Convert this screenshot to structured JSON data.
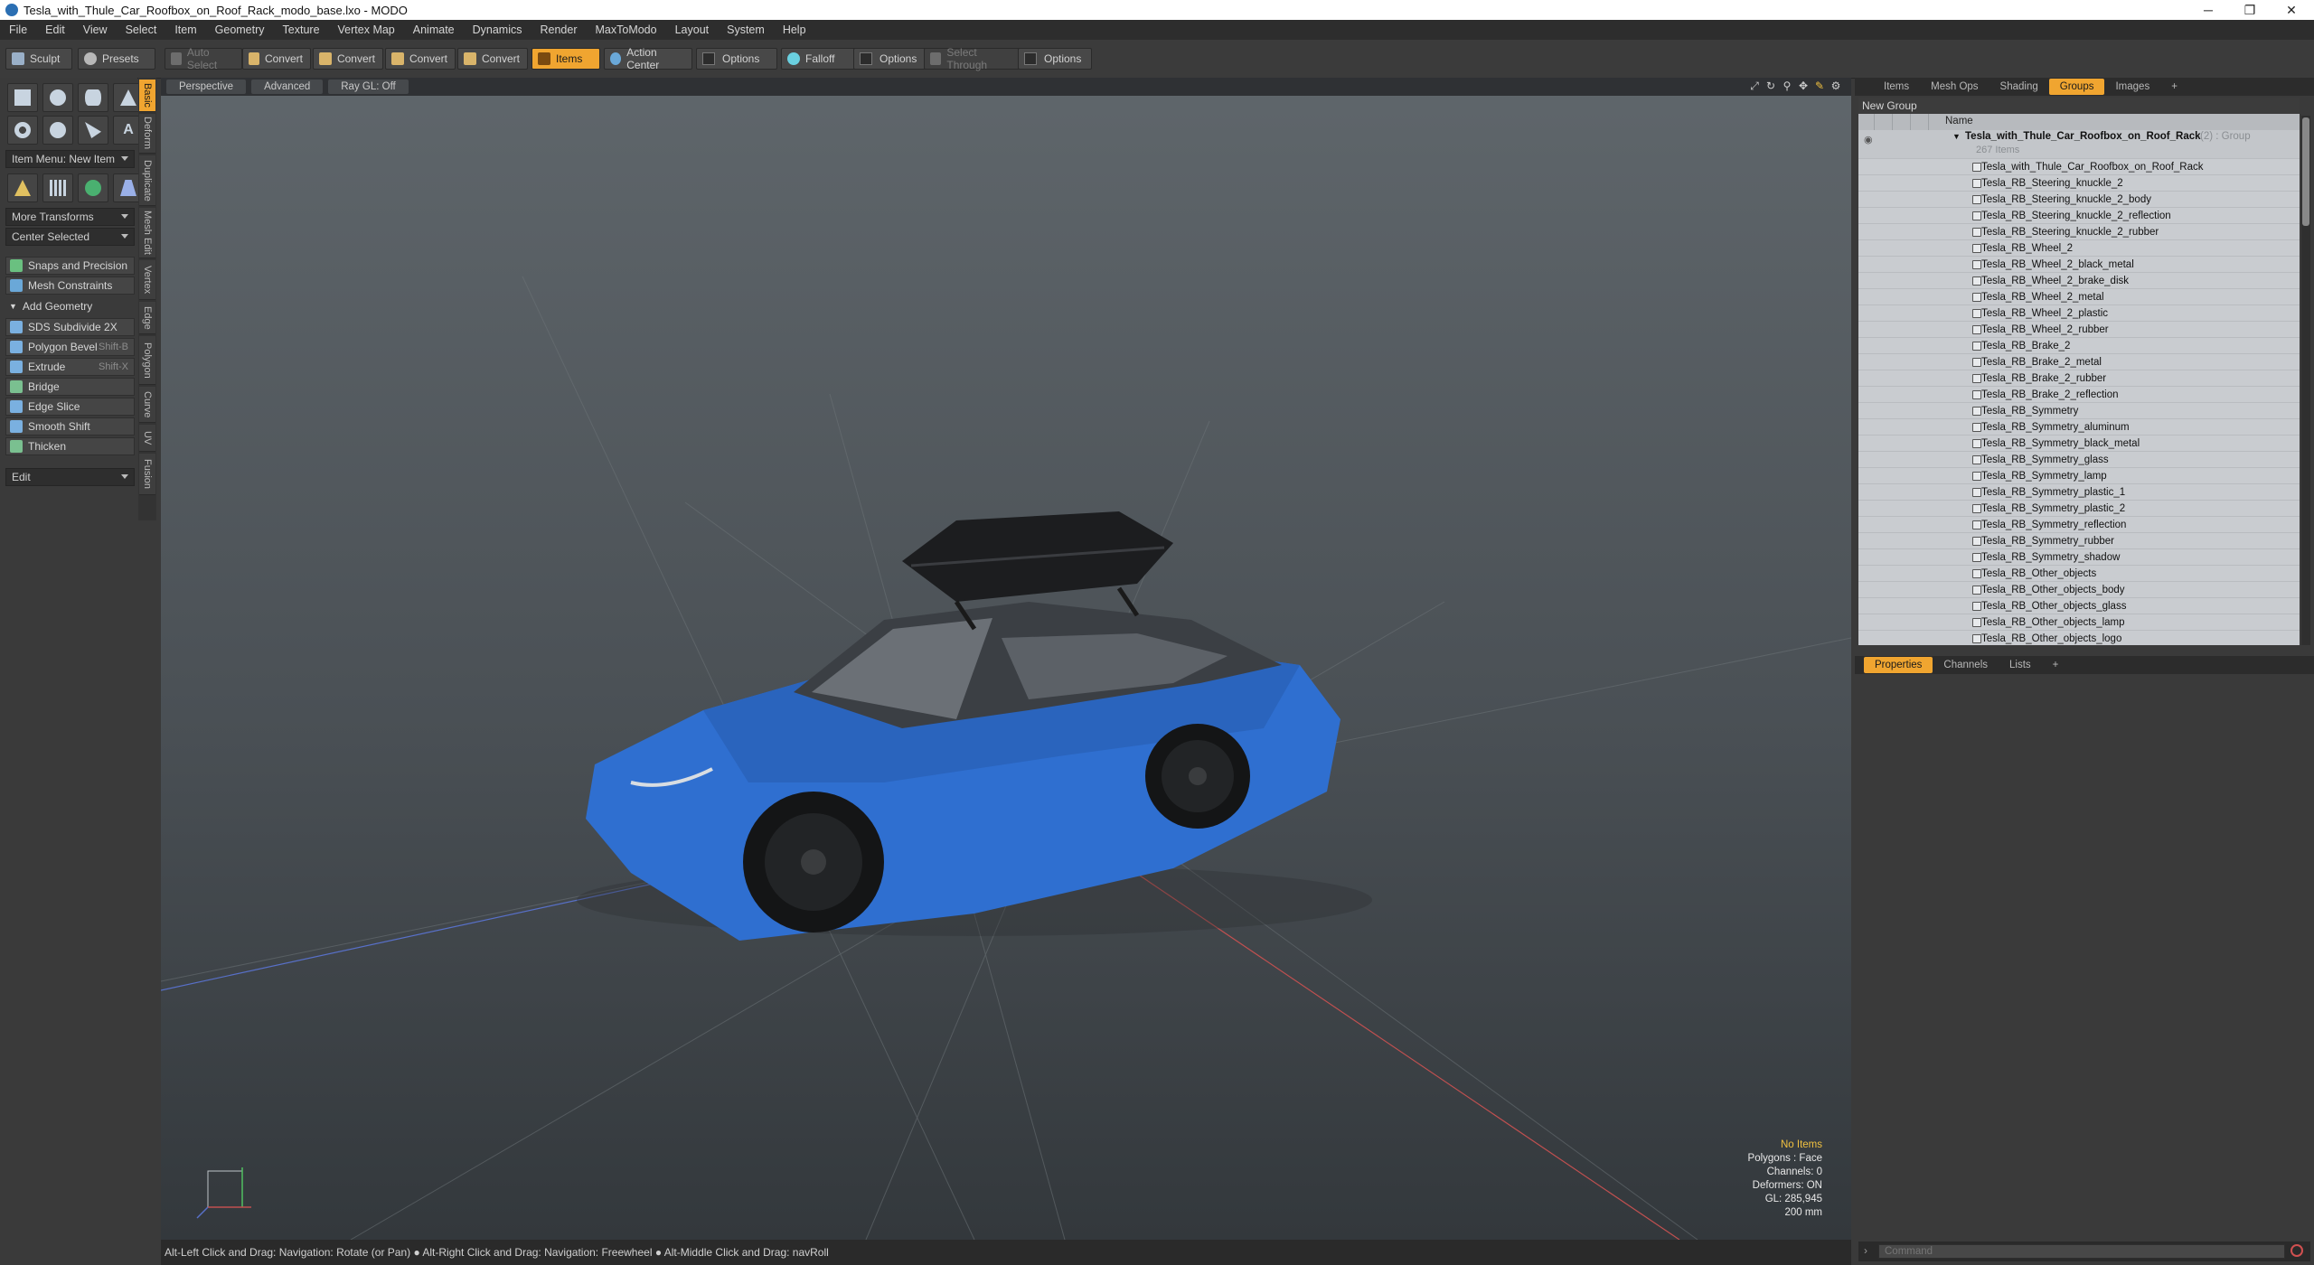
{
  "window": {
    "title": "Tesla_with_Thule_Car_Roofbox_on_Roof_Rack_modo_base.lxo - MODO",
    "minimize_glyph": "─",
    "maximize_glyph": "❐",
    "close_glyph": "✕"
  },
  "menu": [
    "File",
    "Edit",
    "View",
    "Select",
    "Item",
    "Geometry",
    "Texture",
    "Vertex Map",
    "Animate",
    "Dynamics",
    "Render",
    "MaxToModo",
    "Layout",
    "System",
    "Help"
  ],
  "toolbar": {
    "sculpt": "Sculpt",
    "presets": "Presets",
    "auto_select": "Auto Select",
    "convert1": "Convert",
    "convert2": "Convert",
    "convert3": "Convert",
    "convert4": "Convert",
    "items": "Items",
    "action_center": "Action Center",
    "options1": "Options",
    "falloff": "Falloff",
    "options2": "Options",
    "select_through": "Select Through",
    "options3": "Options"
  },
  "left_panel": {
    "item_menu": "Item Menu: New Item",
    "more_transforms": "More Transforms",
    "center_selected": "Center Selected",
    "snaps": "Snaps and Precision",
    "mesh_constraints": "Mesh Constraints",
    "add_geometry": "Add Geometry",
    "sds_subdivide": "SDS Subdivide 2X",
    "polygon_bevel": "Polygon Bevel",
    "polygon_bevel_shortcut": "Shift-B",
    "extrude": "Extrude",
    "extrude_shortcut": "Shift-X",
    "bridge": "Bridge",
    "edge_slice": "Edge Slice",
    "smooth_shift": "Smooth Shift",
    "thicken": "Thicken",
    "edit": "Edit"
  },
  "vertical_tabs": [
    "Basic",
    "Deform",
    "Duplicate",
    "Mesh Edit",
    "Vertex",
    "Edge",
    "Polygon",
    "Curve",
    "UV",
    "Fusion"
  ],
  "viewport": {
    "tabs": [
      "Perspective",
      "Advanced",
      "Ray GL: Off"
    ],
    "stats": {
      "no_items": "No Items",
      "polygons": "Polygons : Face",
      "channels": "Channels: 0",
      "deformers": "Deformers: ON",
      "gl": "GL: 285,945",
      "scale": "200 mm"
    }
  },
  "status_bar": "Alt-Left Click and Drag: Navigation: Rotate (or Pan) ● Alt-Right Click and Drag: Navigation: Freewheel ● Alt-Middle Click and Drag: navRoll",
  "right_panel": {
    "tabs": [
      "Items",
      "Mesh Ops",
      "Shading",
      "Groups",
      "Images"
    ],
    "add_tab": "+",
    "new_group": "New Group",
    "column_name": "Name",
    "group_name": "Tesla_with_Thule_Car_Roofbox_on_Roof_Rack",
    "group_suffix": "(2) : Group",
    "group_count": "267 Items",
    "items": [
      "Tesla_with_Thule_Car_Roofbox_on_Roof_Rack",
      "Tesla_RB_Steering_knuckle_2",
      "Tesla_RB_Steering_knuckle_2_body",
      "Tesla_RB_Steering_knuckle_2_reflection",
      "Tesla_RB_Steering_knuckle_2_rubber",
      "Tesla_RB_Wheel_2",
      "Tesla_RB_Wheel_2_black_metal",
      "Tesla_RB_Wheel_2_brake_disk",
      "Tesla_RB_Wheel_2_metal",
      "Tesla_RB_Wheel_2_plastic",
      "Tesla_RB_Wheel_2_rubber",
      "Tesla_RB_Brake_2",
      "Tesla_RB_Brake_2_metal",
      "Tesla_RB_Brake_2_rubber",
      "Tesla_RB_Brake_2_reflection",
      "Tesla_RB_Symmetry",
      "Tesla_RB_Symmetry_aluminum",
      "Tesla_RB_Symmetry_black_metal",
      "Tesla_RB_Symmetry_glass",
      "Tesla_RB_Symmetry_lamp",
      "Tesla_RB_Symmetry_plastic_1",
      "Tesla_RB_Symmetry_plastic_2",
      "Tesla_RB_Symmetry_reflection",
      "Tesla_RB_Symmetry_rubber",
      "Tesla_RB_Symmetry_shadow",
      "Tesla_RB_Other_objects",
      "Tesla_RB_Other_objects_body",
      "Tesla_RB_Other_objects_glass",
      "Tesla_RB_Other_objects_lamp",
      "Tesla_RB_Other_objects_logo"
    ],
    "bottom_tabs": [
      "Properties",
      "Channels",
      "Lists"
    ],
    "command_placeholder": "Command"
  },
  "colors": {
    "accent": "#f0a530",
    "car_body": "#2f6fd0",
    "viewport_top": "#5f666b",
    "viewport_bottom": "#33383c"
  }
}
